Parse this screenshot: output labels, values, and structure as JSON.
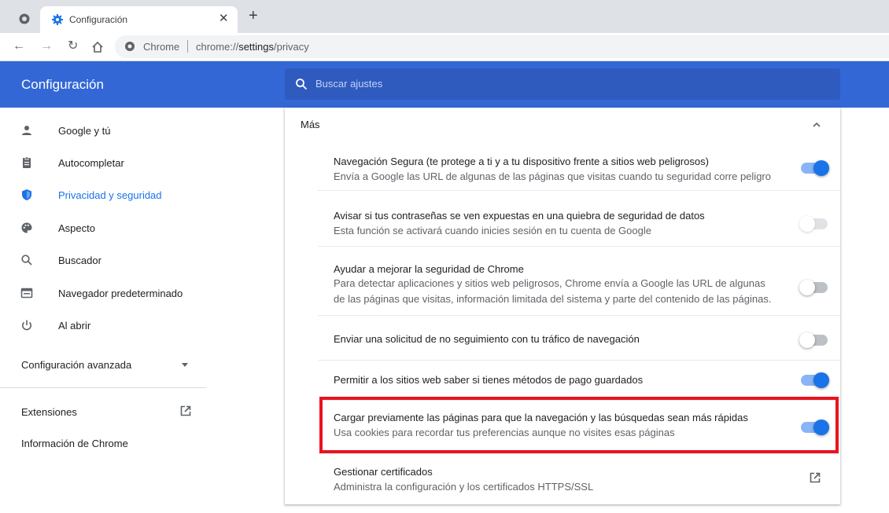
{
  "browser": {
    "tab_title": "Configuración",
    "omnibox_scheme_label": "Chrome",
    "omnibox_url_prefix": "chrome://",
    "omnibox_url_host": "settings",
    "omnibox_url_path": "/privacy"
  },
  "header": {
    "title": "Configuración",
    "search_placeholder": "Buscar ajustes"
  },
  "sidebar": {
    "items": [
      {
        "label": "Google y tú",
        "icon": "person-icon"
      },
      {
        "label": "Autocompletar",
        "icon": "clipboard-icon"
      },
      {
        "label": "Privacidad y seguridad",
        "icon": "shield-icon",
        "active": true
      },
      {
        "label": "Aspecto",
        "icon": "palette-icon"
      },
      {
        "label": "Buscador",
        "icon": "search-icon"
      },
      {
        "label": "Navegador predeterminado",
        "icon": "browser-icon"
      },
      {
        "label": "Al abrir",
        "icon": "power-icon"
      }
    ],
    "advanced_label": "Configuración avanzada",
    "extensions_label": "Extensiones",
    "about_label": "Información de Chrome"
  },
  "main": {
    "section_label": "Más",
    "rows": [
      {
        "title": "Navegación Segura (te protege a ti y a tu dispositivo frente a sitios web peligrosos)",
        "subtitle": "Envía a Google las URL de algunas de las páginas que visitas cuando tu seguridad corre peligro",
        "toggle": "on"
      },
      {
        "title": "Avisar si tus contraseñas se ven expuestas en una quiebra de seguridad de datos",
        "subtitle": "Esta función se activará cuando inicies sesión en tu cuenta de Google",
        "toggle": "off-disabled"
      },
      {
        "title": "Ayudar a mejorar la seguridad de Chrome",
        "subtitle": "Para detectar aplicaciones y sitios web peligrosos, Chrome envía a Google las URL de algunas",
        "subtitle2": "de las páginas que visitas, información limitada del sistema y parte del contenido de las páginas.",
        "toggle": "off"
      },
      {
        "title": "Enviar una solicitud de no seguimiento con tu tráfico de navegación",
        "toggle": "off"
      },
      {
        "title": "Permitir a los sitios web saber si tienes métodos de pago guardados",
        "toggle": "on"
      },
      {
        "title": "Cargar previamente las páginas para que la navegación y las búsquedas sean más rápidas",
        "subtitle": "Usa cookies para recordar tus preferencias aunque no visites esas páginas",
        "toggle": "on"
      },
      {
        "title": "Gestionar certificados",
        "subtitle": "Administra la configuración y los certificados HTTPS/SSL",
        "icon": "external-link-icon"
      }
    ]
  },
  "colors": {
    "header_blue": "#3367d6",
    "accent_blue": "#1a73e8",
    "highlight_red": "#e8141e"
  }
}
